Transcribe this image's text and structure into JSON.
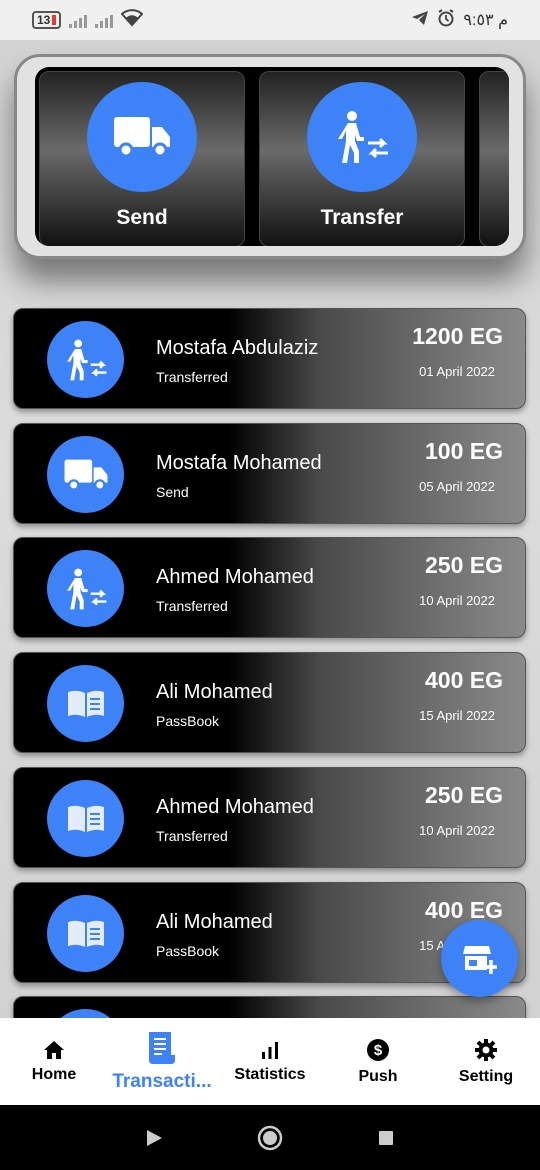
{
  "status_bar": {
    "battery": "13",
    "time": "م ٩:٥٣"
  },
  "actions": [
    {
      "label": "Send",
      "icon": "truck-icon"
    },
    {
      "label": "Transfer",
      "icon": "person-transfer-icon"
    }
  ],
  "transactions": [
    {
      "name": "Mostafa Abdulaziz",
      "type": "Transferred",
      "amount": "1200 EG",
      "date": "01 April 2022",
      "icon": "person-transfer-icon"
    },
    {
      "name": "Mostafa Mohamed",
      "type": "Send",
      "amount": "100 EG",
      "date": "05 April 2022",
      "icon": "truck-icon"
    },
    {
      "name": "Ahmed Mohamed",
      "type": "Transferred",
      "amount": "250 EG",
      "date": "10 April 2022",
      "icon": "person-transfer-icon"
    },
    {
      "name": "Ali Mohamed",
      "type": "PassBook",
      "amount": "400 EG",
      "date": "15 April 2022",
      "icon": "book-icon"
    },
    {
      "name": "Ahmed Mohamed",
      "type": "Transferred",
      "amount": "250 EG",
      "date": "10 April 2022",
      "icon": "book-icon"
    },
    {
      "name": "Ali Mohamed",
      "type": "PassBook",
      "amount": "400 EG",
      "date": "15 April 2022",
      "icon": "book-icon"
    }
  ],
  "fab": {
    "icon": "store-add-icon"
  },
  "bottom_nav": [
    {
      "label": "Home",
      "icon": "home-icon",
      "active": false
    },
    {
      "label": "Transacti...",
      "icon": "receipt-icon",
      "active": true
    },
    {
      "label": "Statistics",
      "icon": "bar-chart-icon",
      "active": false
    },
    {
      "label": "Push",
      "icon": "dollar-icon",
      "active": false
    },
    {
      "label": "Setting",
      "icon": "gear-icon",
      "active": false
    }
  ],
  "colors": {
    "accent": "#3d82f6",
    "card_dark": "#000000"
  }
}
